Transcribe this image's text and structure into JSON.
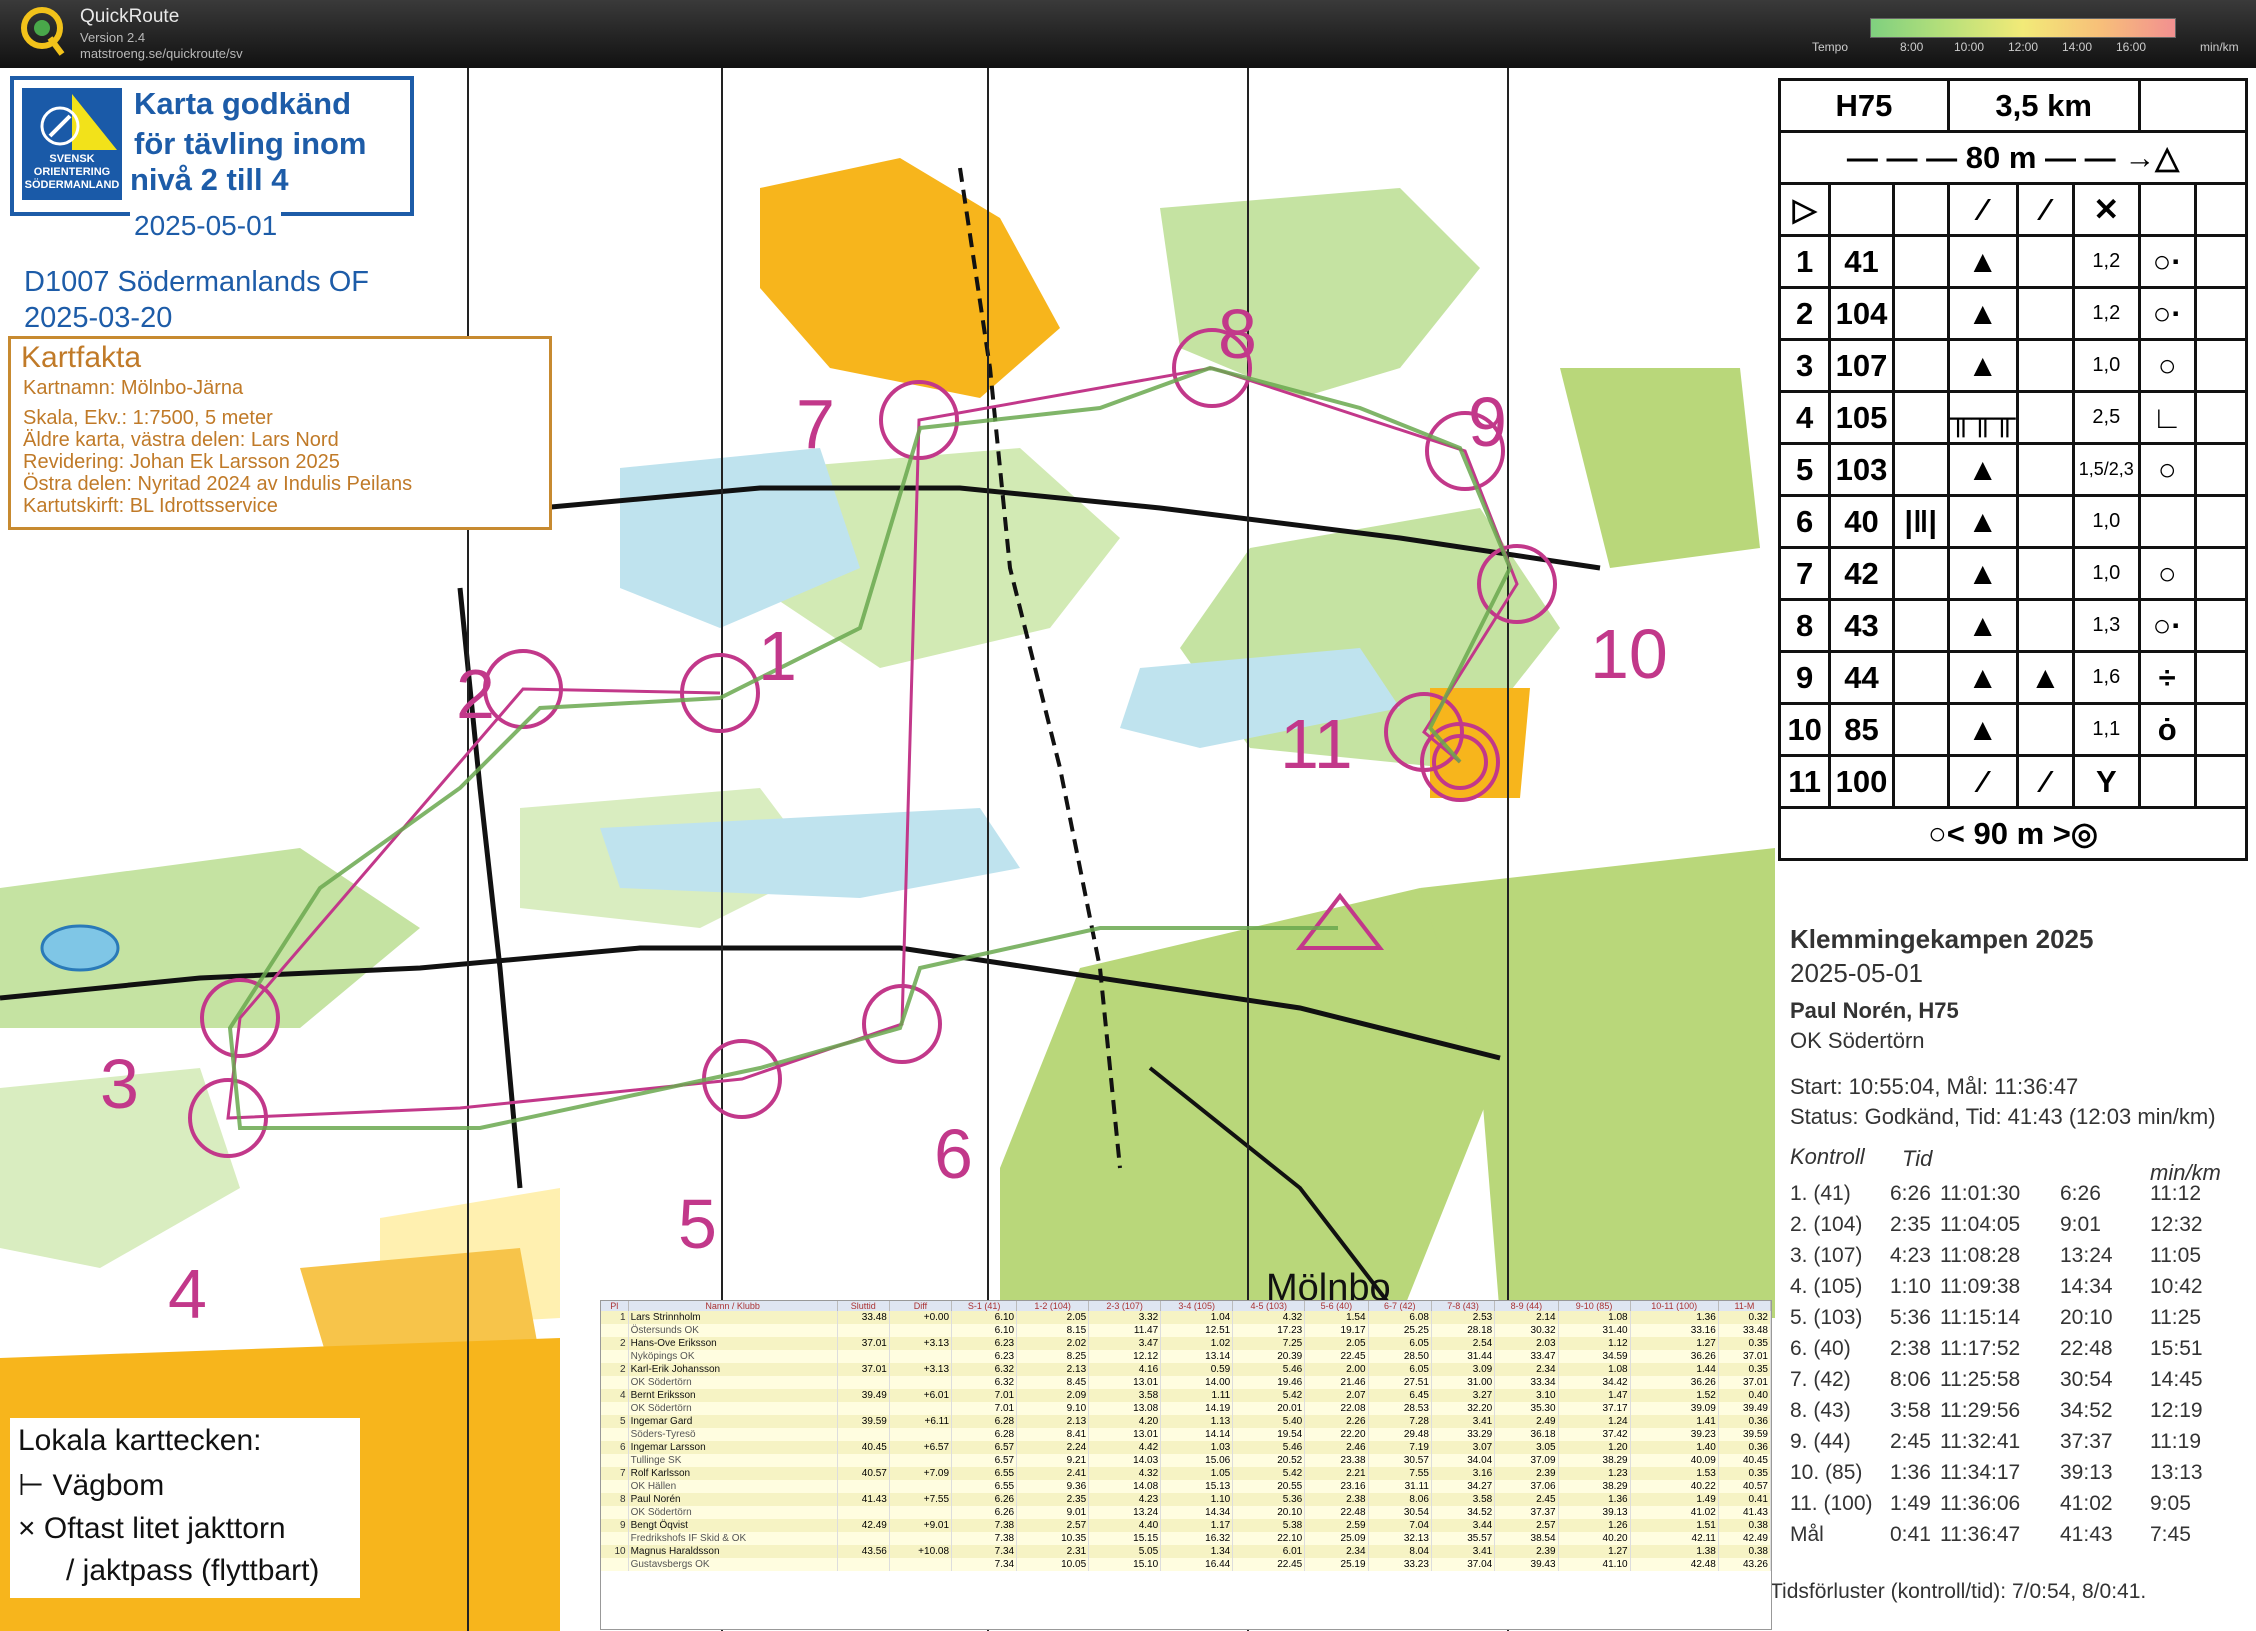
{
  "app": {
    "title": "QuickRoute",
    "version": "Version 2.4",
    "url": "matstroeng.se/quickroute/sv"
  },
  "tempo": {
    "label": "Tempo",
    "ticks": [
      "8:00",
      "10:00",
      "12:00",
      "14:00",
      "16:00"
    ],
    "unit": "min/km"
  },
  "approval": {
    "seal": [
      "SVENSK",
      "ORIENTERING",
      "SÖDERMANLAND"
    ],
    "lines": [
      "Karta godkänd",
      "för tävling inom",
      "nivå 2 till 4"
    ],
    "date": "2025-05-01"
  },
  "map_id": [
    "D1007 Södermanlands OF",
    "2025-03-20"
  ],
  "kartfakta": {
    "heading": "Kartfakta",
    "lines": [
      "Kartnamn:  Mölnbo-Järna",
      "Skala, Ekv.:  1:7500,  5 meter",
      "Äldre karta, västra delen: Lars Nord",
      "Revidering: Johan Ek Larsson 2025",
      "Östra delen: Nyritad 2024 av Indulis Peilans",
      "Kartutskirft:  BL Idrottsservice"
    ]
  },
  "map_labels": {
    "controls": [
      "1",
      "2",
      "3",
      "4",
      "5",
      "6",
      "7",
      "8",
      "9",
      "10",
      "11"
    ],
    "place": "Mölnbo"
  },
  "control_description": {
    "class": "H75",
    "length": "3,5 km",
    "start_dist": "80 m",
    "finish_dist": "90 m",
    "rows": [
      {
        "n": "1",
        "code": "41",
        "size": "1,2"
      },
      {
        "n": "2",
        "code": "104",
        "size": "1,2"
      },
      {
        "n": "3",
        "code": "107",
        "size": "1,0"
      },
      {
        "n": "4",
        "code": "105",
        "size": "2,5"
      },
      {
        "n": "5",
        "code": "103",
        "size": "1,5/2,3"
      },
      {
        "n": "6",
        "code": "40",
        "size": "1,0"
      },
      {
        "n": "7",
        "code": "42",
        "size": "1,0"
      },
      {
        "n": "8",
        "code": "43",
        "size": "1,3"
      },
      {
        "n": "9",
        "code": "44",
        "size": "1,6"
      },
      {
        "n": "10",
        "code": "85",
        "size": "1,1"
      },
      {
        "n": "11",
        "code": "100",
        "size": ""
      }
    ]
  },
  "runner_info": {
    "event": "Klemmingekampen 2025",
    "date": "2025-05-01",
    "runner": "Paul Norén, H75",
    "club": "OK Södertörn",
    "start_finish": "Start: 10:55:04, Mål: 11:36:47",
    "status": "Status: Godkänd, Tid: 41:43 (12:03 min/km)",
    "col_kontroll": "Kontroll",
    "col_tid": "Tid",
    "col_minkm": "min/km",
    "splits": [
      {
        "k": "1.   (41)",
        "leg": "6:26",
        "clock": "11:01:30",
        "tot": "6:26",
        "pace": "11:12"
      },
      {
        "k": "2.   (104)",
        "leg": "2:35",
        "clock": "11:04:05",
        "tot": "9:01",
        "pace": "12:32"
      },
      {
        "k": "3.   (107)",
        "leg": "4:23",
        "clock": "11:08:28",
        "tot": "13:24",
        "pace": "11:05"
      },
      {
        "k": "4.   (105)",
        "leg": "1:10",
        "clock": "11:09:38",
        "tot": "14:34",
        "pace": "10:42"
      },
      {
        "k": "5.   (103)",
        "leg": "5:36",
        "clock": "11:15:14",
        "tot": "20:10",
        "pace": "11:25"
      },
      {
        "k": "6.   (40)",
        "leg": "2:38",
        "clock": "11:17:52",
        "tot": "22:48",
        "pace": "15:51"
      },
      {
        "k": "7.   (42)",
        "leg": "8:06",
        "clock": "11:25:58",
        "tot": "30:54",
        "pace": "14:45"
      },
      {
        "k": "8.   (43)",
        "leg": "3:58",
        "clock": "11:29:56",
        "tot": "34:52",
        "pace": "12:19"
      },
      {
        "k": "9.   (44)",
        "leg": "2:45",
        "clock": "11:32:41",
        "tot": "37:37",
        "pace": "11:19"
      },
      {
        "k": "10.  (85)",
        "leg": "1:36",
        "clock": "11:34:17",
        "tot": "39:13",
        "pace": "13:13"
      },
      {
        "k": "11.  (100)",
        "leg": "1:49",
        "clock": "11:36:06",
        "tot": "41:02",
        "pace": "9:05"
      },
      {
        "k": "Mål",
        "leg": "0:41",
        "clock": "11:36:47",
        "tot": "41:43",
        "pace": "7:45"
      }
    ],
    "losses": "Tidsförluster (kontroll/tid): 7/0:54, 8/0:41."
  },
  "legend": {
    "heading": "Lokala karttecken:",
    "item1": "Vägbom",
    "item2": "Oftast litet jakttorn",
    "item3": "/ jaktpass (flyttbart)"
  },
  "results": {
    "headers": [
      "Pl",
      "Namn / Klubb",
      "Sluttid",
      "Diff",
      "S-1 (41)",
      "1-2 (104)",
      "2-3 (107)",
      "3-4 (105)",
      "4-5 (103)",
      "5-6 (40)",
      "6-7 (42)",
      "7-8 (43)",
      "8-9 (44)",
      "9-10 (85)",
      "10-11 (100)",
      "11-M"
    ],
    "rows": [
      {
        "pl": "1",
        "name": "Lars Strinnholm",
        "club": "Östersunds OK",
        "time": "33.48",
        "diff": "+0.00",
        "s": [
          "6.10",
          "2.05",
          "3.32",
          "1.04",
          "4.32",
          "1.54",
          "6.08",
          "2.53",
          "2.14",
          "1.08",
          "1.36",
          "0.32"
        ],
        "t": [
          "6.10",
          "8.15",
          "11.47",
          "12.51",
          "17.23",
          "19.17",
          "25.25",
          "28.18",
          "30.32",
          "31.40",
          "33.16",
          "33.48"
        ]
      },
      {
        "pl": "2",
        "name": "Hans-Ove Eriksson",
        "club": "Nyköpings OK",
        "time": "37.01",
        "diff": "+3.13",
        "s": [
          "6.23",
          "2.02",
          "3.47",
          "1.02",
          "7.25",
          "2.05",
          "6.05",
          "2.54",
          "2.03",
          "1.12",
          "1.27",
          "0.35"
        ],
        "t": [
          "6.23",
          "8.25",
          "12.12",
          "13.14",
          "20.39",
          "22.45",
          "28.50",
          "31.44",
          "33.47",
          "34.59",
          "36.26",
          "37.01"
        ]
      },
      {
        "pl": "2",
        "name": "Karl-Erik Johansson",
        "club": "OK Södertörn",
        "time": "37.01",
        "diff": "+3.13",
        "s": [
          "6.32",
          "2.13",
          "4.16",
          "0.59",
          "5.46",
          "2.00",
          "6.05",
          "3.09",
          "2.34",
          "1.08",
          "1.44",
          "0.35"
        ],
        "t": [
          "6.32",
          "8.45",
          "13.01",
          "14.00",
          "19.46",
          "21.46",
          "27.51",
          "31.00",
          "33.34",
          "34.42",
          "36.26",
          "37.01"
        ]
      },
      {
        "pl": "4",
        "name": "Bernt Eriksson",
        "club": "OK Södertörn",
        "time": "39.49",
        "diff": "+6.01",
        "s": [
          "7.01",
          "2.09",
          "3.58",
          "1.11",
          "5.42",
          "2.07",
          "6.45",
          "3.27",
          "3.10",
          "1.47",
          "1.52",
          "0.40"
        ],
        "t": [
          "7.01",
          "9.10",
          "13.08",
          "14.19",
          "20.01",
          "22.08",
          "28.53",
          "32.20",
          "35.30",
          "37.17",
          "39.09",
          "39.49"
        ]
      },
      {
        "pl": "5",
        "name": "Ingemar Gard",
        "club": "Söders-Tyresö",
        "time": "39.59",
        "diff": "+6.11",
        "s": [
          "6.28",
          "2.13",
          "4.20",
          "1.13",
          "5.40",
          "2.26",
          "7.28",
          "3.41",
          "2.49",
          "1.24",
          "1.41",
          "0.36"
        ],
        "t": [
          "6.28",
          "8.41",
          "13.01",
          "14.14",
          "19.54",
          "22.20",
          "29.48",
          "33.29",
          "36.18",
          "37.42",
          "39.23",
          "39.59"
        ]
      },
      {
        "pl": "6",
        "name": "Ingemar Larsson",
        "club": "Tullinge SK",
        "time": "40.45",
        "diff": "+6.57",
        "s": [
          "6.57",
          "2.24",
          "4.42",
          "1.03",
          "5.46",
          "2.46",
          "7.19",
          "3.07",
          "3.05",
          "1.20",
          "1.40",
          "0.36"
        ],
        "t": [
          "6.57",
          "9.21",
          "14.03",
          "15.06",
          "20.52",
          "23.38",
          "30.57",
          "34.04",
          "37.09",
          "38.29",
          "40.09",
          "40.45"
        ]
      },
      {
        "pl": "7",
        "name": "Rolf Karlsson",
        "club": "OK Hällen",
        "time": "40.57",
        "diff": "+7.09",
        "s": [
          "6.55",
          "2.41",
          "4.32",
          "1.05",
          "5.42",
          "2.21",
          "7.55",
          "3.16",
          "2.39",
          "1.23",
          "1.53",
          "0.35"
        ],
        "t": [
          "6.55",
          "9.36",
          "14.08",
          "15.13",
          "20.55",
          "23.16",
          "31.11",
          "34.27",
          "37.06",
          "38.29",
          "40.22",
          "40.57"
        ]
      },
      {
        "pl": "8",
        "name": "Paul Norén",
        "club": "OK Södertörn",
        "time": "41.43",
        "diff": "+7.55",
        "s": [
          "6.26",
          "2.35",
          "4.23",
          "1.10",
          "5.36",
          "2.38",
          "8.06",
          "3.58",
          "2.45",
          "1.36",
          "1.49",
          "0.41"
        ],
        "t": [
          "6.26",
          "9.01",
          "13.24",
          "14.34",
          "20.10",
          "22.48",
          "30.54",
          "34.52",
          "37.37",
          "39.13",
          "41.02",
          "41.43"
        ]
      },
      {
        "pl": "9",
        "name": "Bengt Öqvist",
        "club": "Fredrikshofs IF Skid & OK",
        "time": "42.49",
        "diff": "+9.01",
        "s": [
          "7.38",
          "2.57",
          "4.40",
          "1.17",
          "5.38",
          "2.59",
          "7.04",
          "3.44",
          "2.57",
          "1.26",
          "1.51",
          "0.38"
        ],
        "t": [
          "7.38",
          "10.35",
          "15.15",
          "16.32",
          "22.10",
          "25.09",
          "32.13",
          "35.57",
          "38.54",
          "40.20",
          "42.11",
          "42.49"
        ]
      },
      {
        "pl": "10",
        "name": "Magnus Haraldsson",
        "club": "Gustavsbergs OK",
        "time": "43.56",
        "diff": "+10.08",
        "s": [
          "7.34",
          "2.31",
          "5.05",
          "1.34",
          "6.01",
          "2.34",
          "8.04",
          "3.41",
          "2.39",
          "1.27",
          "1.38",
          "0.38"
        ],
        "t": [
          "7.34",
          "10.05",
          "15.10",
          "16.44",
          "22.45",
          "25.19",
          "33.23",
          "37.04",
          "39.43",
          "41.10",
          "42.48",
          "43.26"
        ]
      }
    ]
  }
}
